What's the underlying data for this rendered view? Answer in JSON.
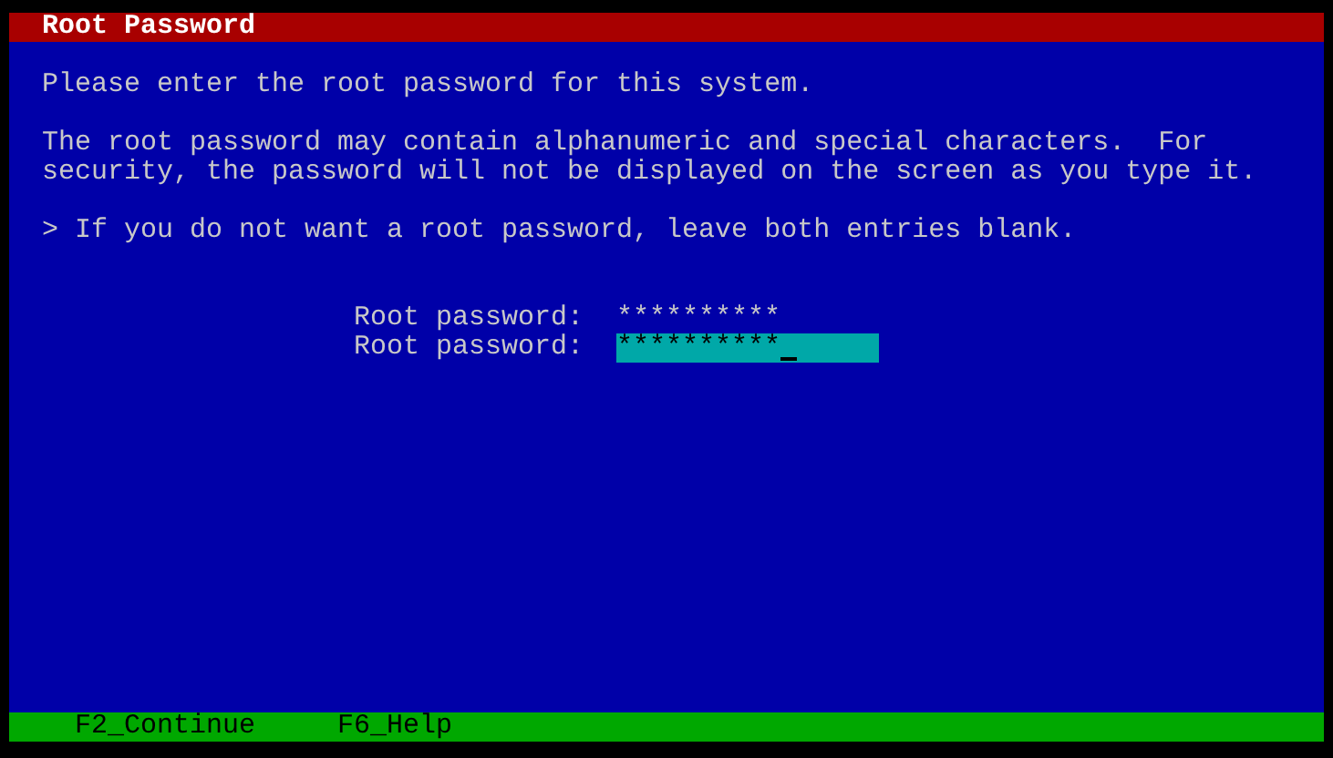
{
  "title_bar": {
    "title": "Root Password"
  },
  "paragraphs": [
    "Please enter the root password for this system.",
    "The root password may contain alphanumeric and special characters.  For\nsecurity, the password will not be displayed on the screen as you type it.",
    "> If you do not want a root password, leave both entries blank."
  ],
  "fields": [
    {
      "label": "Root password:",
      "value": "**********",
      "focused": false
    },
    {
      "label": "Root password:",
      "value": "**********",
      "focused": true
    }
  ],
  "footer_keys": [
    "F2_Continue",
    "F6_Help"
  ]
}
